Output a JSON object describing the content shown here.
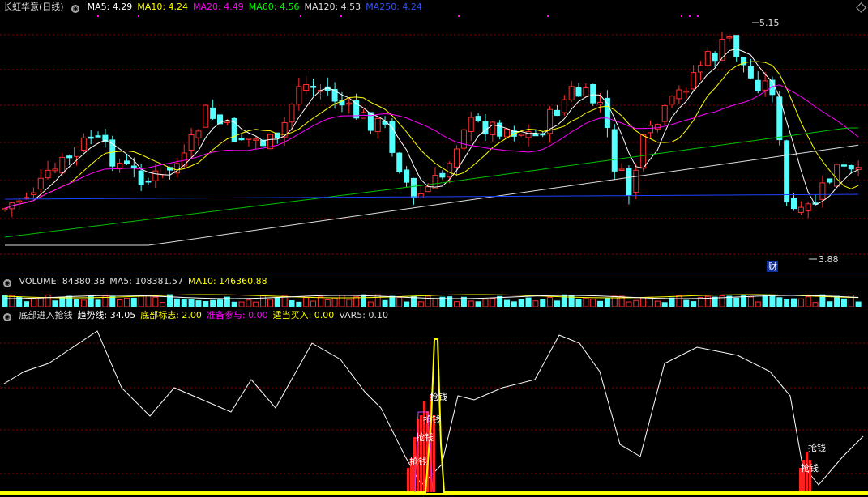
{
  "main_panel": {
    "title": "长虹华意(日线)",
    "indicators": [
      {
        "label": "MA5: 4.29",
        "color": "#ffffff"
      },
      {
        "label": "MA10: 4.24",
        "color": "#ffff00"
      },
      {
        "label": "MA20: 4.49",
        "color": "#ff00ff"
      },
      {
        "label": "MA60: 4.56",
        "color": "#00ff00"
      },
      {
        "label": "MA120: 4.53",
        "color": "#dddddd"
      },
      {
        "label": "MA250: 4.24",
        "color": "#3050ff"
      }
    ],
    "high_label": "5.15",
    "low_label": "3.88",
    "badge": "财"
  },
  "volume_panel": {
    "indicators": [
      {
        "label": "VOLUME: 84380.38",
        "color": "#dddddd"
      },
      {
        "label": "MA5: 108381.57",
        "color": "#dddddd"
      },
      {
        "label": "MA10: 146360.88",
        "color": "#ffff00"
      }
    ]
  },
  "indicator_panel": {
    "indicators": [
      {
        "label": "底部进入抢钱",
        "color": "#dddddd"
      },
      {
        "label": "趋势线: 34.05",
        "color": "#ffffff"
      },
      {
        "label": "底部标志: 2.00",
        "color": "#ffff00"
      },
      {
        "label": "准备参与: 0.00",
        "color": "#ff00ff"
      },
      {
        "label": "适当买入: 0.00",
        "color": "#ffff00"
      },
      {
        "label": "VAR5: 0.10",
        "color": "#dddddd"
      }
    ],
    "signal_text": "抢钱"
  },
  "colors": {
    "up": "#ff3030",
    "down": "#54ffff",
    "grid": "#8b0000"
  },
  "chart_data": {
    "type": "candlestick",
    "price_high": 5.15,
    "price_low": 3.88
  }
}
